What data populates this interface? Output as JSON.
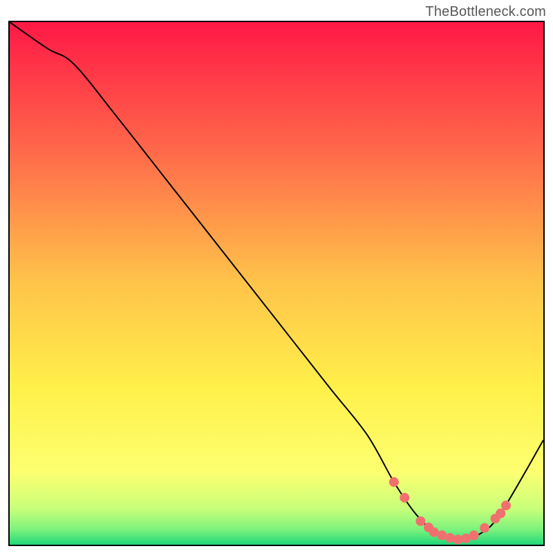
{
  "attribution": "TheBottleneck.com",
  "chart_data": {
    "type": "line",
    "title": "",
    "xlabel": "",
    "ylabel": "",
    "xlim": [
      0,
      100
    ],
    "ylim": [
      0,
      100
    ],
    "x": [
      0,
      7,
      12,
      20,
      30,
      40,
      50,
      60,
      67,
      72,
      76,
      80,
      84,
      88,
      92,
      100
    ],
    "y": [
      100,
      95,
      92,
      82,
      69,
      56,
      43,
      30,
      21,
      12,
      6,
      2,
      1,
      2,
      6,
      20
    ],
    "markers": [
      {
        "x": 72,
        "y": 12
      },
      {
        "x": 74,
        "y": 9
      },
      {
        "x": 77,
        "y": 4.5
      },
      {
        "x": 78.5,
        "y": 3.3
      },
      {
        "x": 79.5,
        "y": 2.4
      },
      {
        "x": 81,
        "y": 1.8
      },
      {
        "x": 82.5,
        "y": 1.3
      },
      {
        "x": 84,
        "y": 1.0
      },
      {
        "x": 85.5,
        "y": 1.2
      },
      {
        "x": 87,
        "y": 1.8
      },
      {
        "x": 89,
        "y": 3.2
      },
      {
        "x": 91,
        "y": 5.0
      },
      {
        "x": 92,
        "y": 6.0
      },
      {
        "x": 93,
        "y": 7.5
      }
    ],
    "gradient_stops": [
      {
        "offset": 0,
        "color": "#ff1846"
      },
      {
        "offset": 25,
        "color": "#ff6a4a"
      },
      {
        "offset": 50,
        "color": "#ffc44a"
      },
      {
        "offset": 70,
        "color": "#fff04a"
      },
      {
        "offset": 86,
        "color": "#fdff70"
      },
      {
        "offset": 93,
        "color": "#c8ff7a"
      },
      {
        "offset": 97,
        "color": "#7cf27c"
      },
      {
        "offset": 100,
        "color": "#1bd67a"
      }
    ],
    "marker_color": "#f07070",
    "curve_color": "#000000"
  }
}
